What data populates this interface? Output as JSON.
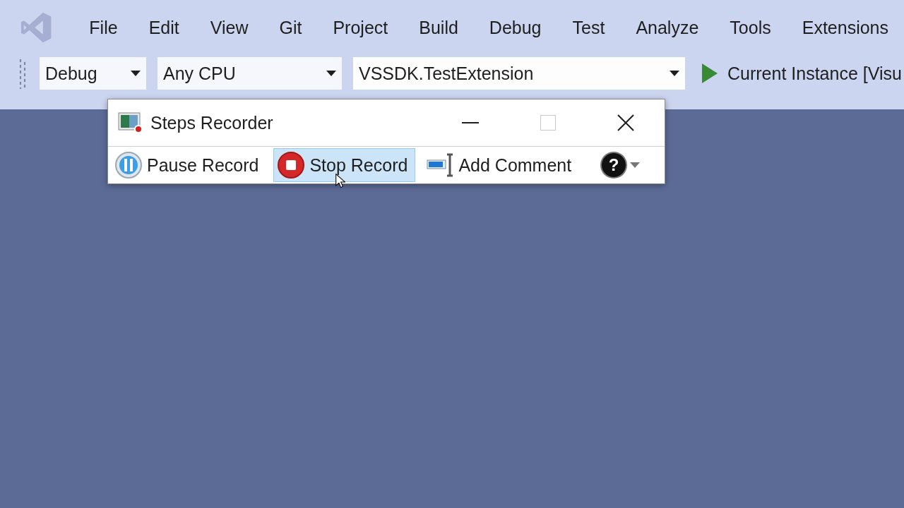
{
  "menu": [
    {
      "label": "File"
    },
    {
      "label": "Edit"
    },
    {
      "label": "View"
    },
    {
      "label": "Git"
    },
    {
      "label": "Project"
    },
    {
      "label": "Build"
    },
    {
      "label": "Debug"
    },
    {
      "label": "Test"
    },
    {
      "label": "Analyze"
    },
    {
      "label": "Tools"
    },
    {
      "label": "Extensions"
    }
  ],
  "toolbar": {
    "dropdowns": [
      {
        "value": "Debug",
        "kind": "small"
      },
      {
        "value": "Any CPU",
        "kind": "medium"
      },
      {
        "value": "VSSDK.TestExtension",
        "kind": "large"
      }
    ],
    "run_label": "Current Instance [Visu"
  },
  "recorder": {
    "title": "Steps Recorder",
    "buttons": [
      {
        "label": "Pause Record",
        "kind": "pause",
        "selected": false
      },
      {
        "label": "Stop Record",
        "kind": "stop",
        "selected": true
      },
      {
        "label": "Add Comment",
        "kind": "comment",
        "selected": false
      }
    ],
    "help": "?"
  }
}
